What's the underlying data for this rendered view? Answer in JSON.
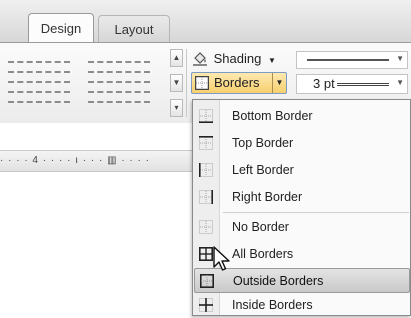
{
  "tabs": [
    {
      "label": "Design",
      "active": true
    },
    {
      "label": "Layout",
      "active": false
    }
  ],
  "ribbon": {
    "shading_label": "Shading",
    "borders_label": "Borders",
    "pen_weight": "3 pt",
    "accent_color": "#f7cf6e"
  },
  "ruler": {
    "text": "· · · · 4 · · · · ı · · · ▥ · · · ·"
  },
  "borders_menu": {
    "items": [
      {
        "label": "Bottom Border",
        "icon": "bottom-border-icon",
        "group": 1
      },
      {
        "label": "Top Border",
        "icon": "top-border-icon",
        "group": 1
      },
      {
        "label": "Left Border",
        "icon": "left-border-icon",
        "group": 1
      },
      {
        "label": "Right Border",
        "icon": "right-border-icon",
        "group": 1
      },
      {
        "label": "No Border",
        "icon": "no-border-icon",
        "group": 2
      },
      {
        "label": "All Borders",
        "icon": "all-borders-icon",
        "group": 2
      },
      {
        "label": "Outside Borders",
        "icon": "outside-borders-icon",
        "group": 2,
        "hovered": true
      },
      {
        "label": "Inside Borders",
        "icon": "inside-borders-icon",
        "group": 2
      }
    ]
  }
}
